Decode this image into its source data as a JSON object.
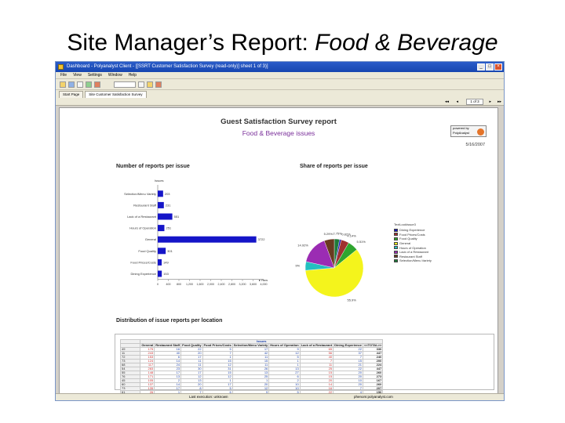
{
  "slide": {
    "title_main": "Site Manager’s Report: ",
    "title_italic": "Food & Beverage"
  },
  "window": {
    "title": "Dashboard - Polyanalyst Client - [[SSRT Customer Satisfaction Survey (read-only)] sheet 1 of 3)]",
    "controls": [
      "_",
      "□",
      "×"
    ]
  },
  "menu": [
    "File",
    "View",
    "Settings",
    "Window",
    "Help"
  ],
  "tabs": [
    "Start Page",
    "Site Customer Satisfaction Survey"
  ],
  "nav": {
    "first": "◂◂",
    "prev": "◂",
    "page": "1 of 3",
    "next": "▸",
    "last": "▸▸"
  },
  "report": {
    "title": "Guest Satisfaction Survey report",
    "subtitle": "Food & Beverage issues",
    "logo_text": "powered by PolyAnalyst",
    "date": "5/16/2007"
  },
  "bar_section_title": "Number of reports per issue",
  "pie_section_title": "Share of reports per issue",
  "table_section_title": "Distribution of issue reports per location",
  "chart_data": [
    {
      "type": "bar",
      "orientation": "horizontal",
      "title": "Number of reports per issue",
      "categories": [
        "Selection/Menu Variety",
        "Restaurant Staff",
        "Lack of a Restaurant",
        "Hours of Operation",
        "General",
        "Food Quality",
        "Food Prices/Costs",
        "Dining Experience"
      ],
      "values": [
        203,
        231,
        551,
        251,
        3722,
        301,
        149,
        153
      ],
      "value_labels": [
        "203",
        "231",
        "551",
        "251",
        "3722",
        "301",
        "149",
        "153"
      ],
      "xlim": [
        0,
        4000
      ],
      "xticks": [
        "0",
        "400",
        "800",
        "1,200",
        "1,600",
        "2,000",
        "2,400",
        "2,800",
        "3,200",
        "3,600",
        "4,000"
      ],
      "ylabel": "Issues",
      "xlabel": "Row",
      "color": "#1515c8"
    },
    {
      "type": "pie",
      "title": "Share of reports per issue",
      "legend_title": "TextLookIssue3",
      "legend_placement": "right",
      "slices": [
        {
          "label": "Selection/Menu Variety",
          "value": 2.75,
          "color": "#1f7a3a"
        },
        {
          "label": "Dining Experience",
          "value": 0.9,
          "color": "#1515b8"
        },
        {
          "label": "Food Prices/Costs",
          "value": 4.14,
          "color": "#a03030"
        },
        {
          "label": "Food Quality",
          "value": 5.51,
          "color": "#2fa52f"
        },
        {
          "label": "General",
          "value": 55.9,
          "color": "#f4f41c"
        },
        {
          "label": "Hours of Operation",
          "value": 4.6,
          "color": "#23c0c0"
        },
        {
          "label": "Lack of a Restaurant",
          "value": 14.92,
          "color": "#9b2cb3"
        },
        {
          "label": "Restaurant Staff",
          "value": 5.29,
          "color": "#6a3a20"
        }
      ],
      "slice_labels": [
        "2.75%",
        "0.82%",
        "4.14%",
        "5.51%",
        "55.9%",
        "4.9%",
        "14.92%",
        "5.29%"
      ],
      "legend_items": [
        "Dining Experience",
        "Food Prices/Costs",
        "Food Quality",
        "General",
        "Hours of Operation",
        "Lack of a Restaurant",
        "Restaurant Staff",
        "Selection/Menu Variety"
      ]
    },
    {
      "type": "table",
      "title": "Distribution of issue reports per location",
      "group_label": "Issues",
      "row_axis_label": "Property ID",
      "columns": [
        "General",
        "Restaurant Staff",
        "Food Quality",
        "Food Prices/Costs",
        "Selection/Menu Variety",
        "Hours of Operation",
        "Lack of a Restaurant",
        "Dining Experience",
        "<<TOTAL>>"
      ],
      "rows": [
        [
          "49",
          "175",
          "16",
          "22",
          "5",
          "17",
          "9",
          "65",
          "22",
          "336"
        ],
        [
          "11",
          "243",
          "40",
          "20",
          "7",
          "42",
          "12",
          "56",
          "37",
          "447"
        ],
        [
          "72",
          "153",
          "6",
          "17",
          "1",
          "11",
          "5",
          "40",
          "7",
          "240"
        ],
        [
          "73",
          "124",
          "14",
          "11",
          "15",
          "15",
          "1",
          "7",
          "15",
          "200"
        ],
        [
          "68",
          "117",
          "24",
          "11",
          "12",
          "11",
          "1",
          "11",
          "21",
          "224"
        ],
        [
          "54",
          "283",
          "23",
          "30",
          "31",
          "26",
          "13",
          "25",
          "22",
          "447"
        ],
        [
          "55",
          "148",
          "17",
          "17",
          "15",
          "13",
          "27",
          "15",
          "20",
          "260"
        ],
        [
          "76",
          "171",
          "13",
          "12",
          "12",
          "25",
          "6",
          "15",
          "20",
          "273"
        ],
        [
          "45",
          "105",
          "2",
          "13",
          "1",
          "1",
          "2",
          "20",
          "10",
          "167"
        ],
        [
          "60",
          "137",
          "14",
          "20",
          "17",
          "20",
          "10",
          "14",
          "20",
          "260"
        ],
        [
          "73",
          "135",
          "17",
          "8",
          "5",
          "12",
          "10",
          "16",
          "7",
          "207"
        ],
        [
          "61",
          "26",
          "1",
          "7",
          "6",
          "9",
          "5",
          "22",
          "4",
          "156"
        ],
        [
          "67",
          "113",
          "8",
          "7",
          "11",
          "11",
          "7",
          "61",
          "24",
          "306"
        ],
        [
          "53",
          "212",
          "4",
          "10",
          "5",
          "7",
          "6",
          "65",
          "13",
          "332"
        ],
        [
          "64",
          "197",
          "25",
          "53",
          "22",
          "60",
          "16",
          "40",
          "18",
          "421"
        ]
      ],
      "total_row": [
        "<<TOTAL>>",
        "3722",
        "231",
        "301",
        "149",
        "203",
        "251",
        "551",
        "153",
        "4570"
      ]
    }
  ],
  "status": {
    "left": "Last execution: unknown",
    "right": "phenom:polyanalyst.com"
  }
}
